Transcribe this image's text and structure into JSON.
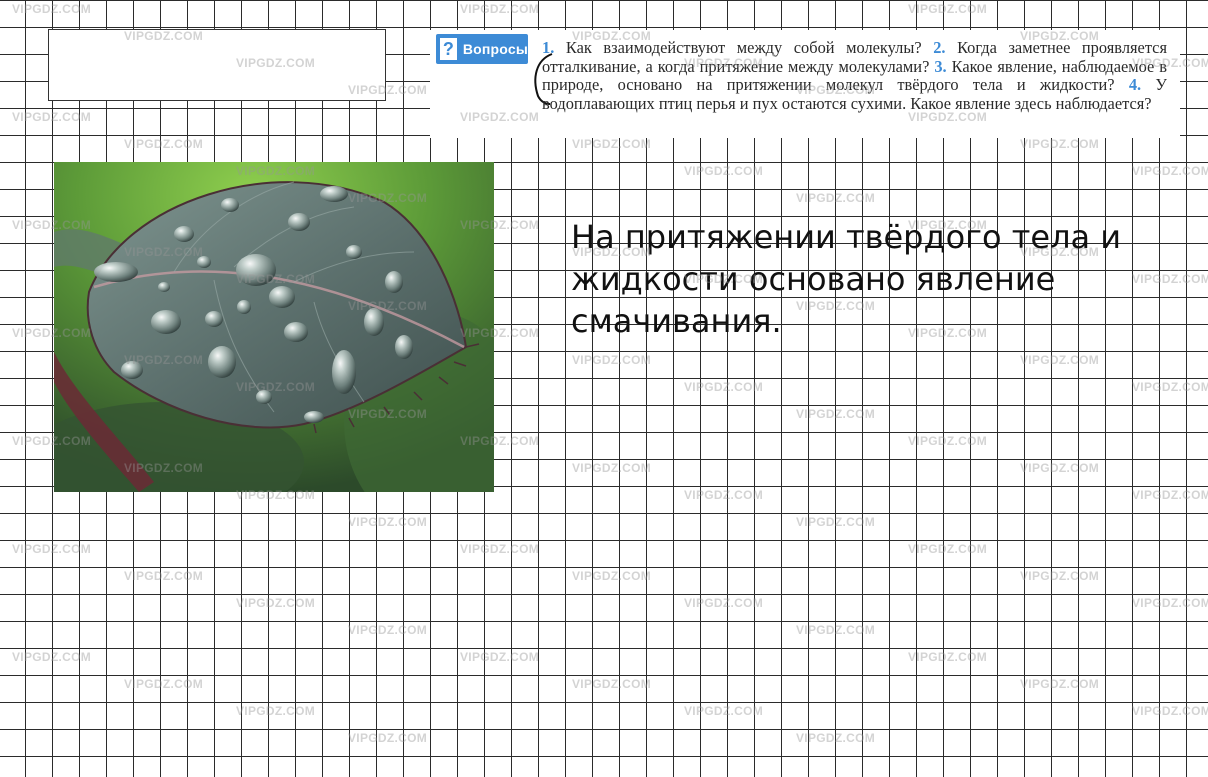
{
  "questions": {
    "badge_label": "Вопросы",
    "badge_icon": "question-mark-icon",
    "items": [
      {
        "num": "1.",
        "text": "Как взаимодействуют между собой молекулы?"
      },
      {
        "num": "2.",
        "text": "Когда заметнее проявляется отталкивание, а когда притяжение между молекулами?"
      },
      {
        "num": "3.",
        "text": "Какое явление, наблюдаемое в природе, основано на притяжении молекул твёрдого тела и жидкости?"
      },
      {
        "num": "4.",
        "text": "У водоплавающих птиц перья и пух остаются сухими. Какое явление здесь наблюдается?"
      }
    ]
  },
  "answer": {
    "text": "На притяжении твёрдого тела и жидкости основано явление смачивания."
  },
  "watermark": {
    "text": "VIPGDZ.COM"
  },
  "colors": {
    "accent_blue": "#3d8bd6",
    "grid_line": "#2b2b2b",
    "watermark": "#969696"
  }
}
